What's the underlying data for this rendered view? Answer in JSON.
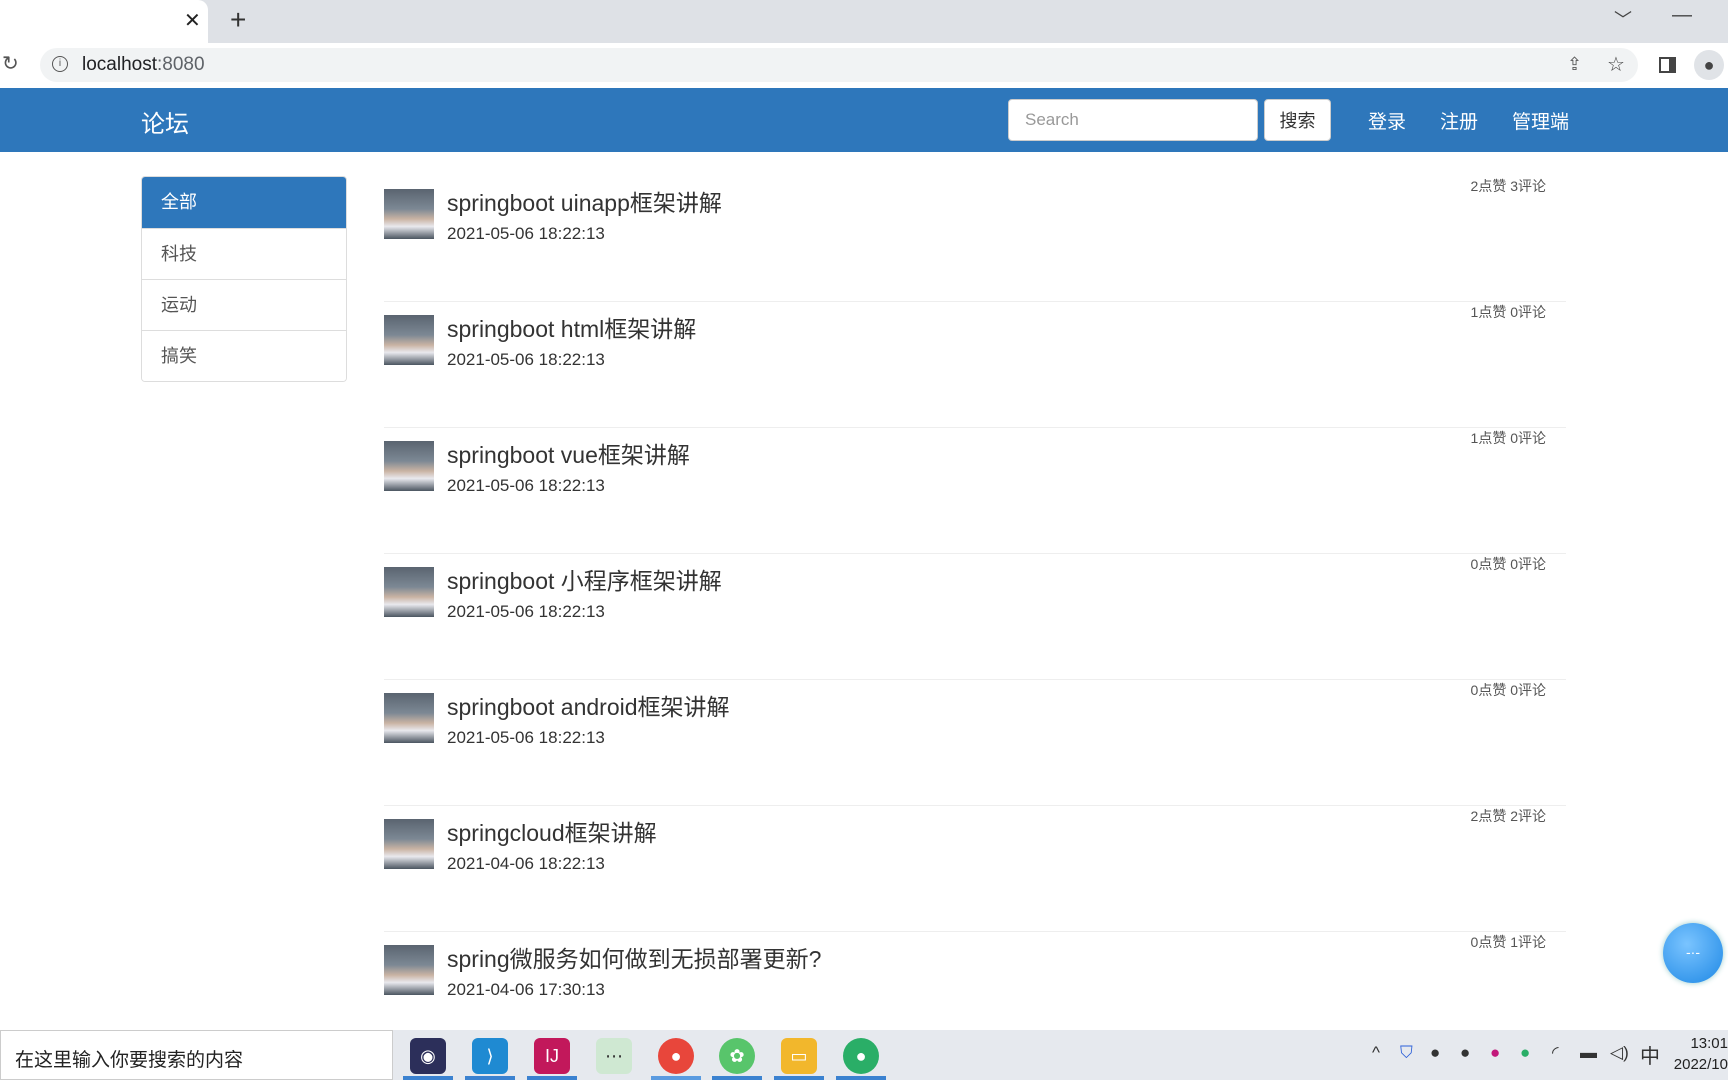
{
  "browser": {
    "tab_close": "✕",
    "new_tab": "+",
    "url_host": "localhost",
    "url_port": ":8080"
  },
  "navbar": {
    "brand": "论坛",
    "search_placeholder": "Search",
    "search_button": "搜索",
    "links": [
      "登录",
      "注册",
      "管理端"
    ],
    "color": "#2e77bb"
  },
  "sidebar": {
    "items": [
      {
        "label": "全部",
        "active": true
      },
      {
        "label": "科技"
      },
      {
        "label": "运动"
      },
      {
        "label": "搞笑"
      }
    ]
  },
  "posts": [
    {
      "title": "springboot uinapp框架讲解",
      "date": "2021-05-06 18:22:13",
      "stats": "2点赞 3评论"
    },
    {
      "title": "springboot html框架讲解",
      "date": "2021-05-06 18:22:13",
      "stats": "1点赞 0评论"
    },
    {
      "title": "springboot vue框架讲解",
      "date": "2021-05-06 18:22:13",
      "stats": "1点赞 0评论"
    },
    {
      "title": "springboot 小程序框架讲解",
      "date": "2021-05-06 18:22:13",
      "stats": "0点赞 0评论"
    },
    {
      "title": "springboot android框架讲解",
      "date": "2021-05-06 18:22:13",
      "stats": "0点赞 0评论"
    },
    {
      "title": "springcloud框架讲解",
      "date": "2021-04-06 18:22:13",
      "stats": "2点赞 2评论"
    },
    {
      "title": "spring微服务如何做到无损部署更新?",
      "date": "2021-04-06 17:30:13",
      "stats": "0点赞 1评论"
    }
  ],
  "taskbar": {
    "search_text": "在这里输入你要搜索的内容",
    "ime": "中",
    "time": "13:01",
    "date": "2022/10"
  }
}
